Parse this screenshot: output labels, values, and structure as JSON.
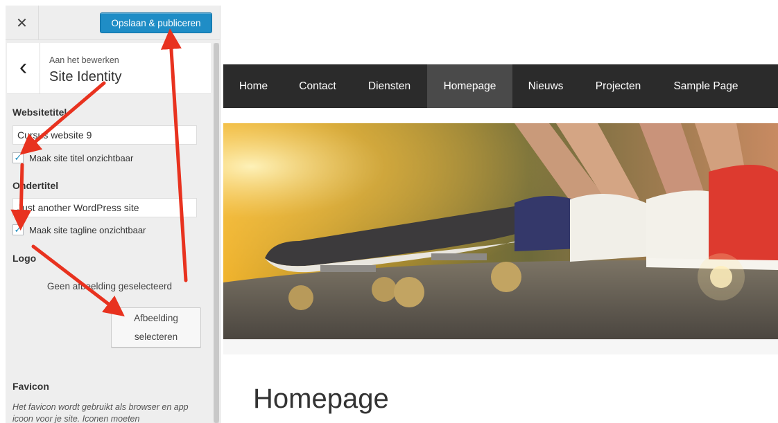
{
  "topbar": {
    "close_symbol": "✕",
    "publish_label": "Opslaan & publiceren"
  },
  "section": {
    "back_symbol": "‹",
    "subtitle": "Aan het bewerken",
    "title": "Site Identity"
  },
  "fields": {
    "site_title_label": "Websitetitel",
    "site_title_value": "Cursus website 9",
    "hide_title_label": "Maak site titel onzichtbaar",
    "hide_title_checked": true,
    "tagline_label": "Ondertitel",
    "tagline_value": "Just another WordPress site",
    "hide_tagline_label": "Maak site tagline onzichtbaar",
    "hide_tagline_checked": true,
    "logo_label": "Logo",
    "no_image_text": "Geen afbeelding geselecteerd",
    "select_image_line1": "Afbeelding",
    "select_image_line2": "selecteren",
    "favicon_label": "Favicon",
    "favicon_desc": "Het favicon wordt gebruikt als browser en app icoon voor je site. Iconen moeten"
  },
  "checkmark_symbol": "✓",
  "nav": {
    "items": [
      "Home",
      "Contact",
      "Diensten",
      "Homepage",
      "Nieuws",
      "Projecten",
      "Sample Page"
    ],
    "active": "Homepage"
  },
  "page": {
    "title": "Homepage"
  },
  "colors": {
    "publish_blue": "#1f8dc6",
    "nav_dark": "#2b2b2b",
    "nav_active": "#4a4a4a",
    "annotation_red": "#e8321f"
  },
  "icons": {
    "close": "close-icon",
    "back": "chevron-left-icon",
    "check": "checkmark-icon"
  }
}
